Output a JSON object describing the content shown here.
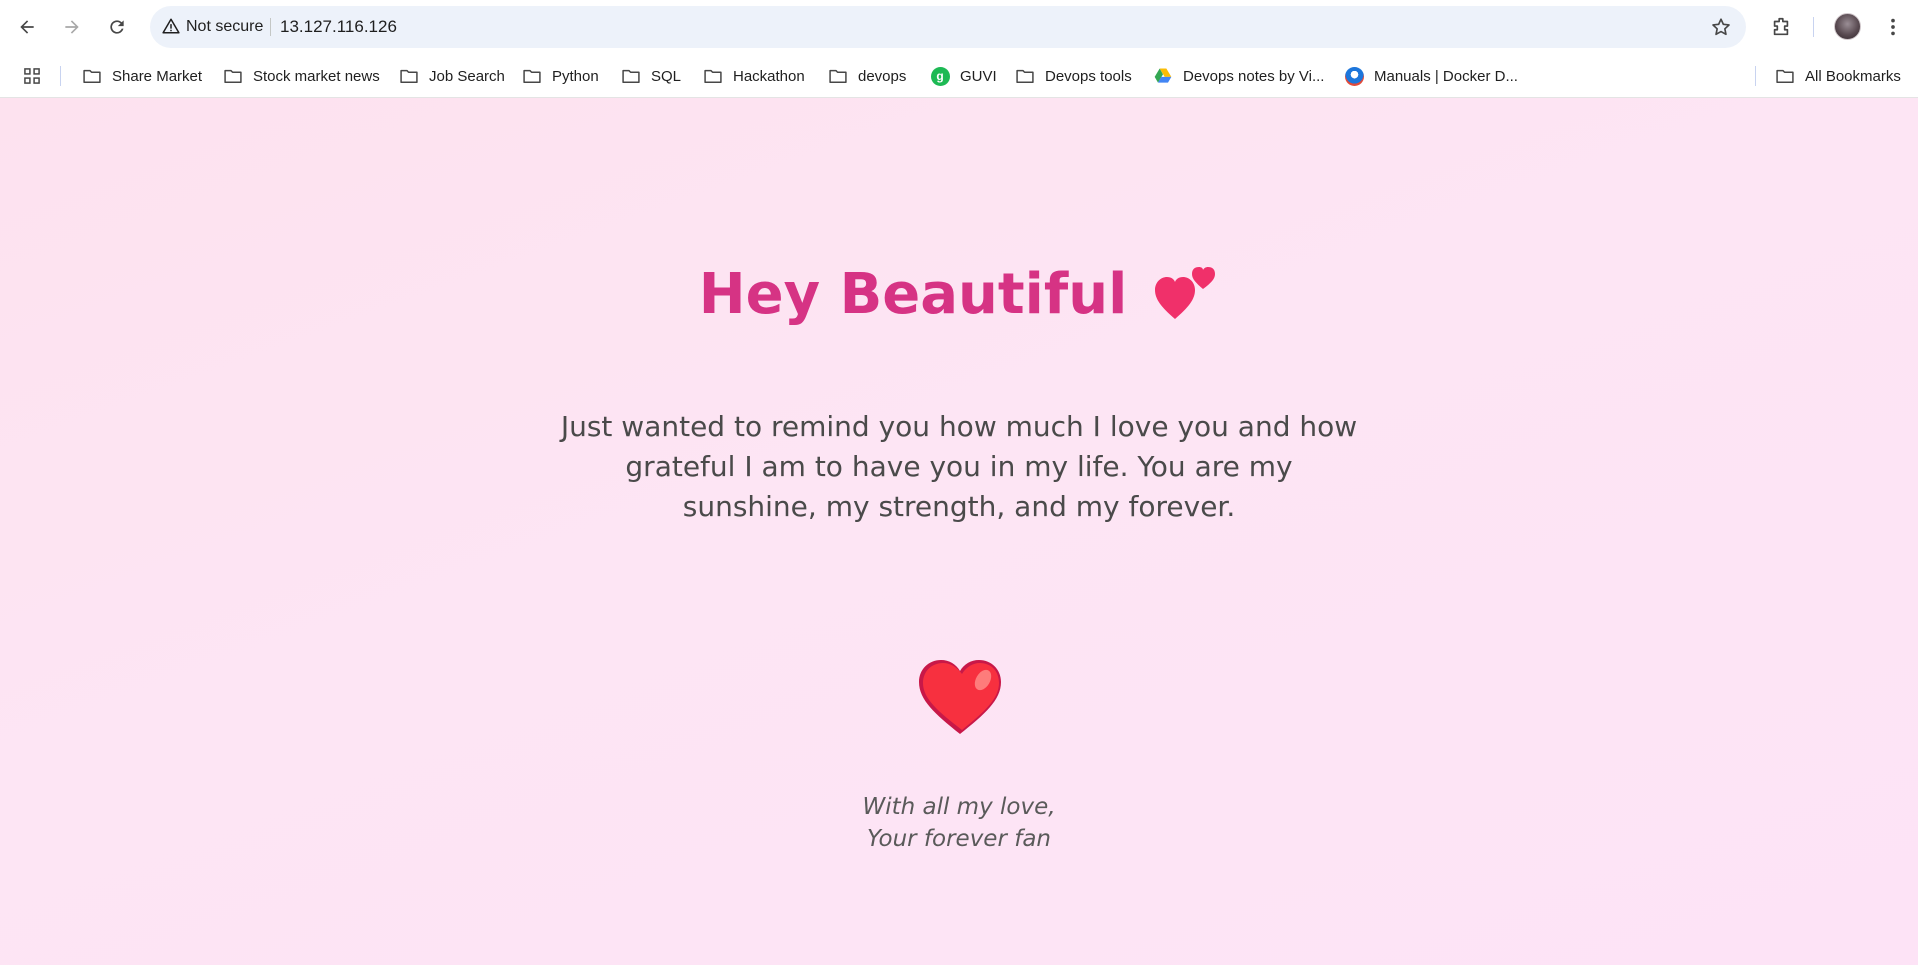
{
  "browser": {
    "security_label": "Not secure",
    "url": "13.127.116.126"
  },
  "bookmarks": {
    "items": [
      {
        "label": "Share Market",
        "icon": "folder-icon"
      },
      {
        "label": "Stock market news",
        "icon": "folder-icon"
      },
      {
        "label": "Job Search",
        "icon": "folder-icon"
      },
      {
        "label": "Python",
        "icon": "folder-icon"
      },
      {
        "label": "SQL",
        "icon": "folder-icon"
      },
      {
        "label": "Hackathon",
        "icon": "folder-icon"
      },
      {
        "label": "devops",
        "icon": "folder-icon"
      },
      {
        "label": "GUVI",
        "icon": "guvi-icon"
      },
      {
        "label": "Devops tools",
        "icon": "folder-icon"
      },
      {
        "label": "Devops notes by Vi...",
        "icon": "google-drive-icon"
      },
      {
        "label": "Manuals | Docker D...",
        "icon": "docker-icon"
      }
    ],
    "all_bookmarks_label": "All Bookmarks",
    "guvi_glyph": "g"
  },
  "page": {
    "heading": "Hey Beautiful",
    "message": "Just wanted to remind you how much I love you and how grateful I am to have you in my life. You are my sunshine, my strength, and my forever.",
    "signature_line1": "With all my love,",
    "signature_line2": "Your forever fan",
    "accent_color": "#d63384",
    "background_color": "#fde4f3"
  }
}
